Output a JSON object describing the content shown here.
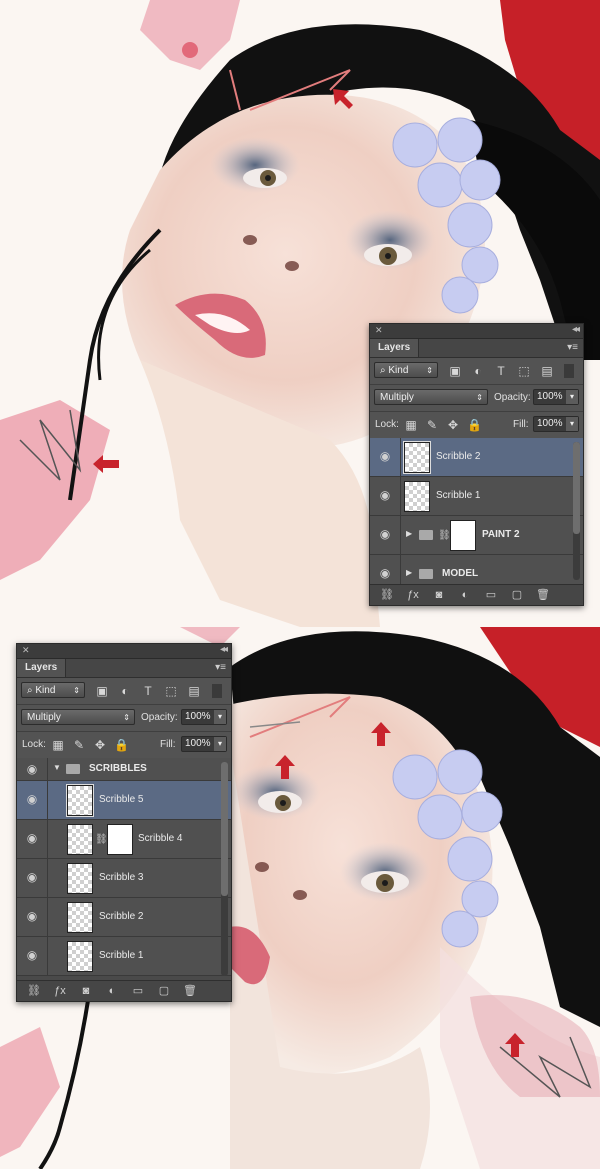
{
  "panel_top": {
    "tab": "Layers",
    "filter": "Kind",
    "blend_mode": "Multiply",
    "opacity_label": "Opacity:",
    "opacity_value": "100%",
    "lock_label": "Lock:",
    "fill_label": "Fill:",
    "fill_value": "100%",
    "layers": [
      {
        "name": "Scribble 2"
      },
      {
        "name": "Scribble 1"
      },
      {
        "name": "PAINT 2"
      },
      {
        "name": "MODEL"
      }
    ]
  },
  "panel_bottom": {
    "tab": "Layers",
    "filter": "Kind",
    "blend_mode": "Multiply",
    "opacity_label": "Opacity:",
    "opacity_value": "100%",
    "lock_label": "Lock:",
    "fill_label": "Fill:",
    "fill_value": "100%",
    "layers": [
      {
        "name": "SCRIBBLES"
      },
      {
        "name": "Scribble 5"
      },
      {
        "name": "Scribble 4"
      },
      {
        "name": "Scribble 3"
      },
      {
        "name": "Scribble 2"
      },
      {
        "name": "Scribble 1"
      }
    ]
  },
  "colors": {
    "accent_arrow": "#c8232c",
    "selected_layer": "#5b6a84",
    "panel_bg": "#535353"
  },
  "icons": [
    "close-icon",
    "collapse-icon",
    "panel-menu-icon",
    "search-icon",
    "image-filter-icon",
    "adjustment-filter-icon",
    "type-filter-icon",
    "shape-filter-icon",
    "smart-object-filter-icon",
    "lock-transparent-icon",
    "lock-brush-icon",
    "lock-move-icon",
    "lock-all-icon",
    "eye-icon",
    "folder-icon",
    "chain-icon",
    "link-icon",
    "fx-icon",
    "mask-icon",
    "adjustment-icon",
    "new-group-icon",
    "new-layer-icon",
    "trash-icon",
    "red-arrow-icon"
  ]
}
